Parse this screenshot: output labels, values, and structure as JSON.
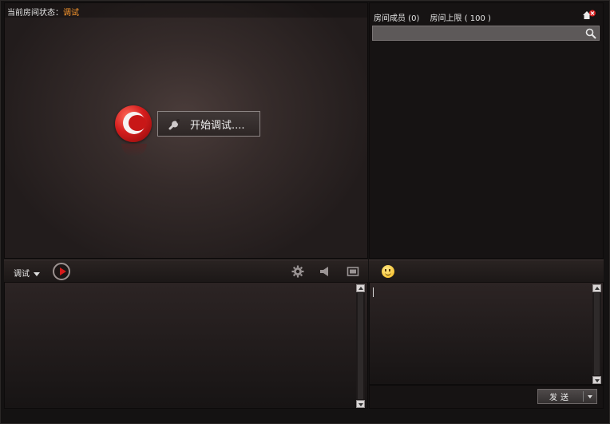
{
  "status": {
    "label": "当前房间状态：",
    "value": "调试"
  },
  "stage": {
    "start_button_label": "开始调试...."
  },
  "members": {
    "count_label": "房间成员 (0)",
    "limit_label": "房间上限 ( 100 )"
  },
  "search": {
    "placeholder": ""
  },
  "toolbar": {
    "mode_label": "调试"
  },
  "send": {
    "label": "发送"
  },
  "colors": {
    "status_value": "#ff9a2e",
    "accent_red": "#d41d1d"
  },
  "icons": [
    "logo-icon",
    "wrench-icon",
    "home-icon",
    "close-icon",
    "search-icon",
    "play-icon",
    "gear-icon",
    "speaker-icon",
    "screen-icon",
    "emoji-icon"
  ]
}
